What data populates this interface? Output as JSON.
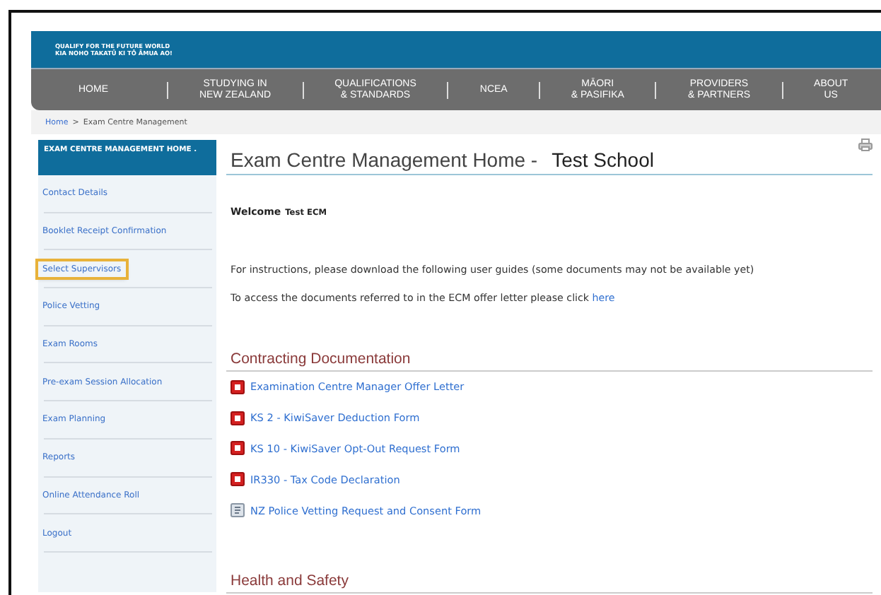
{
  "banner": {
    "tagline_lines": [
      "QUALIFY FOR THE FUTURE WORLD",
      "KIA NOHO TAKATŪ KI TŌ ĀMUA AO!"
    ]
  },
  "nav": [
    {
      "lines": [
        "HOME"
      ]
    },
    {
      "lines": [
        "STUDYING IN",
        "NEW ZEALAND"
      ]
    },
    {
      "lines": [
        "QUALIFICATIONS",
        "& STANDARDS"
      ]
    },
    {
      "lines": [
        "NCEA"
      ]
    },
    {
      "lines": [
        "MĀORI",
        "& PASIFIKA"
      ]
    },
    {
      "lines": [
        "PROVIDERS",
        "& PARTNERS"
      ]
    },
    {
      "lines": [
        "ABOUT",
        "US"
      ]
    }
  ],
  "breadcrumb": {
    "link": "Home",
    "separator": ">",
    "current": "Exam Centre Management"
  },
  "sidebar": {
    "header": "EXAM CENTRE MANAGEMENT HOME .",
    "items": [
      {
        "label": "Contact Details",
        "highlighted": false
      },
      {
        "label": "Booklet Receipt Confirmation",
        "highlighted": false
      },
      {
        "label": "Select Supervisors",
        "highlighted": true
      },
      {
        "label": "Police Vetting",
        "highlighted": false
      },
      {
        "label": "Exam Rooms",
        "highlighted": false
      },
      {
        "label": "Pre-exam Session Allocation",
        "highlighted": false
      },
      {
        "label": "Exam Planning",
        "highlighted": false
      },
      {
        "label": "Reports",
        "highlighted": false
      },
      {
        "label": "Online Attendance Roll",
        "highlighted": false
      },
      {
        "label": "Logout",
        "highlighted": false
      }
    ]
  },
  "main": {
    "title": "Exam Centre Management Home -",
    "school": "Test School",
    "welcome_label": "Welcome",
    "welcome_name": "Test ECM",
    "instructions": "For instructions, please download the following user guides (some documents may not be available yet)",
    "access_text": "To access the documents referred to in the ECM offer letter please click",
    "access_link": "here",
    "sections": [
      {
        "heading": "Contracting Documentation",
        "documents": [
          {
            "kind": "pdf",
            "title": "Examination Centre Manager Offer Letter"
          },
          {
            "kind": "pdf",
            "title": "KS 2 - KiwiSaver Deduction Form"
          },
          {
            "kind": "pdf",
            "title": "KS 10 - KiwiSaver Opt-Out Request Form"
          },
          {
            "kind": "pdf",
            "title": "IR330 - Tax Code Declaration"
          },
          {
            "kind": "form",
            "title": "NZ Police Vetting Request and Consent Form"
          }
        ]
      },
      {
        "heading": "Health and Safety"
      }
    ]
  }
}
